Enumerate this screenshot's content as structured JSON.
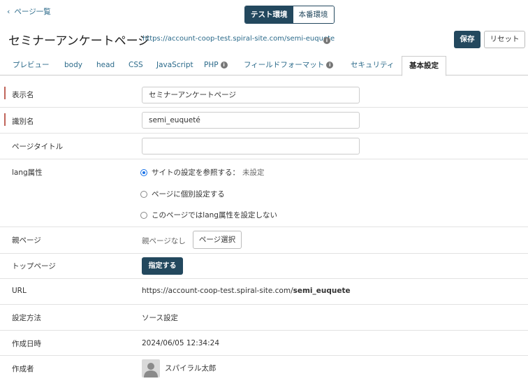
{
  "header": {
    "back_chevron": "‹",
    "back_label": "ページ一覧",
    "env_test": "テスト環境",
    "env_prod": "本番環境",
    "page_title": "セミナーアンケートページ",
    "page_url": "https://account-coop-test.spiral-site.com/semi-euquete",
    "save_label": "保存",
    "reset_label": "リセット",
    "info_glyph": "i"
  },
  "tabs": [
    {
      "label": "プレビュー"
    },
    {
      "label": "body"
    },
    {
      "label": "head"
    },
    {
      "label": "CSS"
    },
    {
      "label": "JavaScript"
    },
    {
      "label": "PHP"
    },
    {
      "label": "フィールドフォーマット"
    },
    {
      "label": "セキュリティ"
    },
    {
      "label": "基本設定"
    }
  ],
  "form": {
    "display_name_label": "表示名",
    "display_name_value": "セミナーアンケートページ",
    "id_name_label": "識別名",
    "id_name_value": "semi_euqueté",
    "page_title_label": "ページタイトル",
    "page_title_value": "",
    "lang_label": "lang属性",
    "lang_options": [
      {
        "label": "サイトの設定を参照する：",
        "sub": "未設定",
        "checked": true
      },
      {
        "label": "ページに個別設定する",
        "sub": "",
        "checked": false
      },
      {
        "label": "このページではlang属性を設定しない",
        "sub": "",
        "checked": false
      }
    ],
    "parent_label": "親ページ",
    "parent_value": "親ページなし",
    "parent_button": "ページ選択",
    "top_label": "トップページ",
    "top_button": "指定する",
    "url_label": "URL",
    "url_prefix": "https://account-coop-test.spiral-site.com/",
    "url_slug": "semi_euquete",
    "method_label": "設定方法",
    "method_value": "ソース設定",
    "created_label": "作成日時",
    "created_value": "2024/06/05 12:34:24",
    "author_label": "作成者",
    "author_value": "スパイラル太郎"
  },
  "colors": {
    "primary": "#23485e",
    "link": "#2b6a8a",
    "required_bar": "#c0645a",
    "radio_checked": "#1a73e8"
  }
}
